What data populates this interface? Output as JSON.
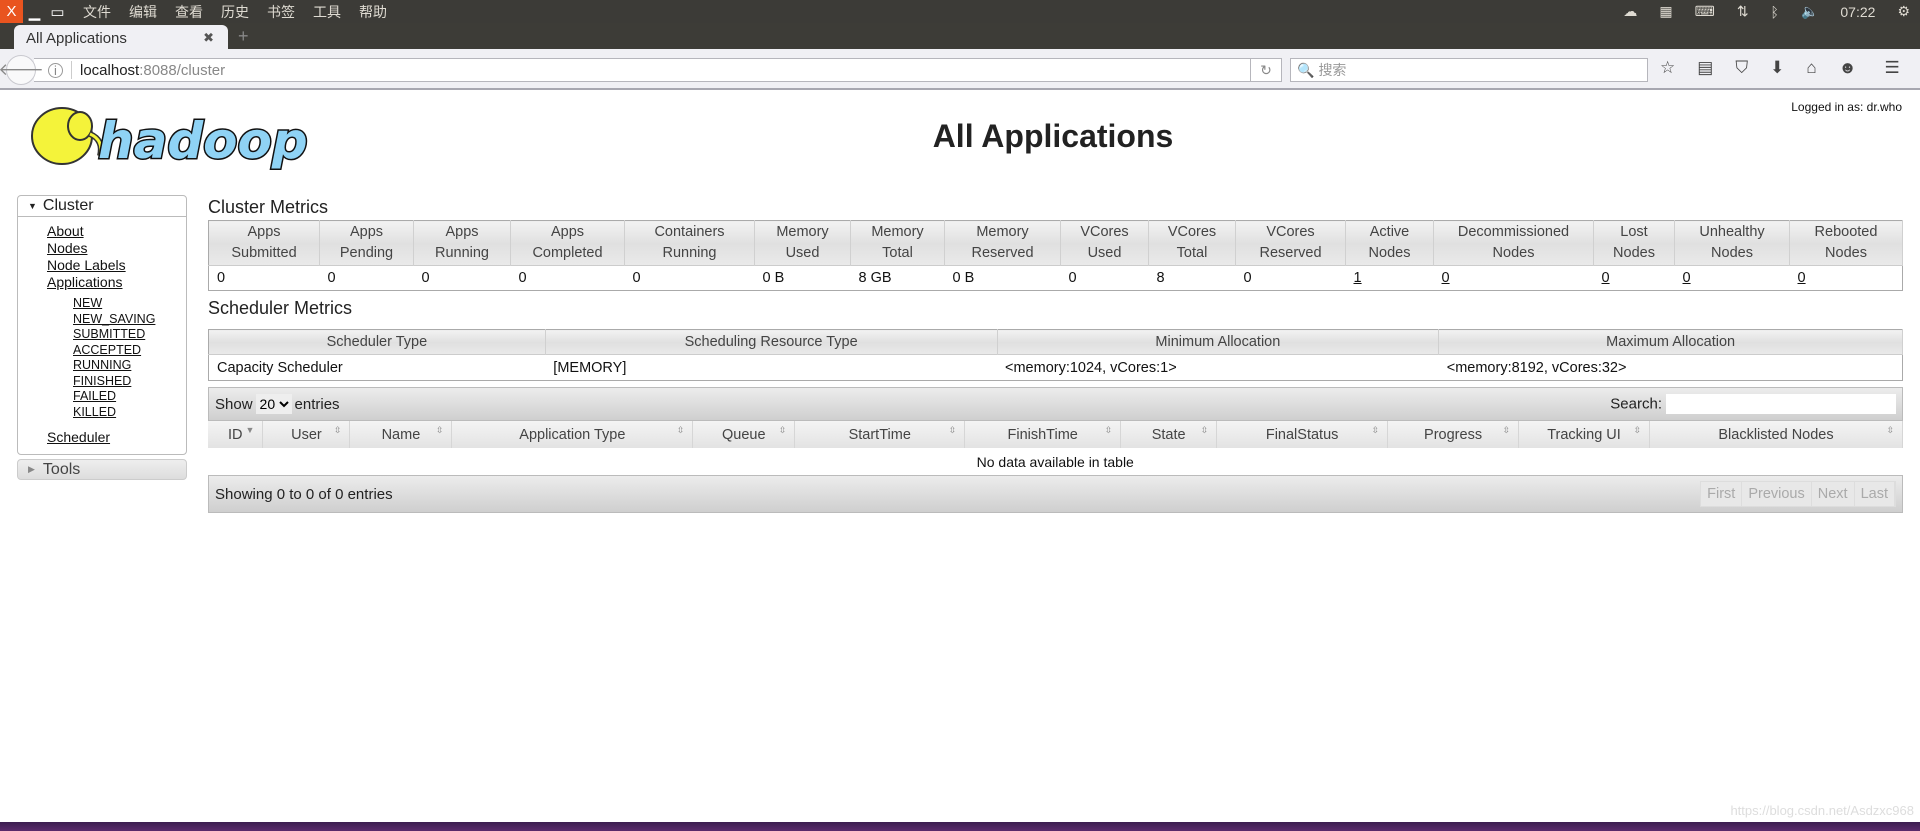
{
  "os": {
    "menu": [
      "文件",
      "编辑",
      "查看",
      "历史",
      "书签",
      "工具",
      "帮助"
    ],
    "clock": "07:22",
    "close_glyph": "X"
  },
  "browser": {
    "tab_title": "All Applications",
    "url_host": "localhost",
    "url_path": ":8088/cluster",
    "search_placeholder": "搜索"
  },
  "header": {
    "title": "All Applications",
    "logged_in": "Logged in as: dr.who",
    "logo_text": "hadoop"
  },
  "sidebar": {
    "cluster_label": "Cluster",
    "links": [
      "About",
      "Nodes",
      "Node Labels",
      "Applications"
    ],
    "app_states": [
      "NEW",
      "NEW_SAVING",
      "SUBMITTED",
      "ACCEPTED",
      "RUNNING",
      "FINISHED",
      "FAILED",
      "KILLED"
    ],
    "scheduler": "Scheduler",
    "tools_label": "Tools"
  },
  "cluster_metrics": {
    "title": "Cluster Metrics",
    "headers": [
      [
        "Apps",
        "Submitted"
      ],
      [
        "Apps",
        "Pending"
      ],
      [
        "Apps",
        "Running"
      ],
      [
        "Apps",
        "Completed"
      ],
      [
        "Containers",
        "Running"
      ],
      [
        "Memory",
        "Used"
      ],
      [
        "Memory",
        "Total"
      ],
      [
        "Memory",
        "Reserved"
      ],
      [
        "VCores",
        "Used"
      ],
      [
        "VCores",
        "Total"
      ],
      [
        "VCores",
        "Reserved"
      ],
      [
        "Active",
        "Nodes"
      ],
      [
        "Decommissioned",
        "Nodes"
      ],
      [
        "Lost",
        "Nodes"
      ],
      [
        "Unhealthy",
        "Nodes"
      ],
      [
        "Rebooted",
        "Nodes"
      ]
    ],
    "values": [
      "0",
      "0",
      "0",
      "0",
      "0",
      "0 B",
      "8 GB",
      "0 B",
      "0",
      "8",
      "0",
      "1",
      "0",
      "0",
      "0",
      "0"
    ],
    "linked": [
      false,
      false,
      false,
      false,
      false,
      false,
      false,
      false,
      false,
      false,
      false,
      true,
      true,
      true,
      true,
      true
    ]
  },
  "scheduler_metrics": {
    "title": "Scheduler Metrics",
    "headers": [
      "Scheduler Type",
      "Scheduling Resource Type",
      "Minimum Allocation",
      "Maximum Allocation"
    ],
    "values": [
      "Capacity Scheduler",
      "[MEMORY]",
      "<memory:1024, vCores:1>",
      "<memory:8192, vCores:32>"
    ]
  },
  "apps_table": {
    "show": "Show",
    "entries_value": "20",
    "entries": "entries",
    "search_label": "Search:",
    "columns": [
      "ID",
      "User",
      "Name",
      "Application Type",
      "Queue",
      "StartTime",
      "FinishTime",
      "State",
      "FinalStatus",
      "Progress",
      "Tracking UI",
      "Blacklisted Nodes"
    ],
    "empty": "No data available in table",
    "info": "Showing 0 to 0 of 0 entries",
    "pager": [
      "First",
      "Previous",
      "Next",
      "Last"
    ]
  },
  "watermark": "https://blog.csdn.net/Asdzxc968"
}
